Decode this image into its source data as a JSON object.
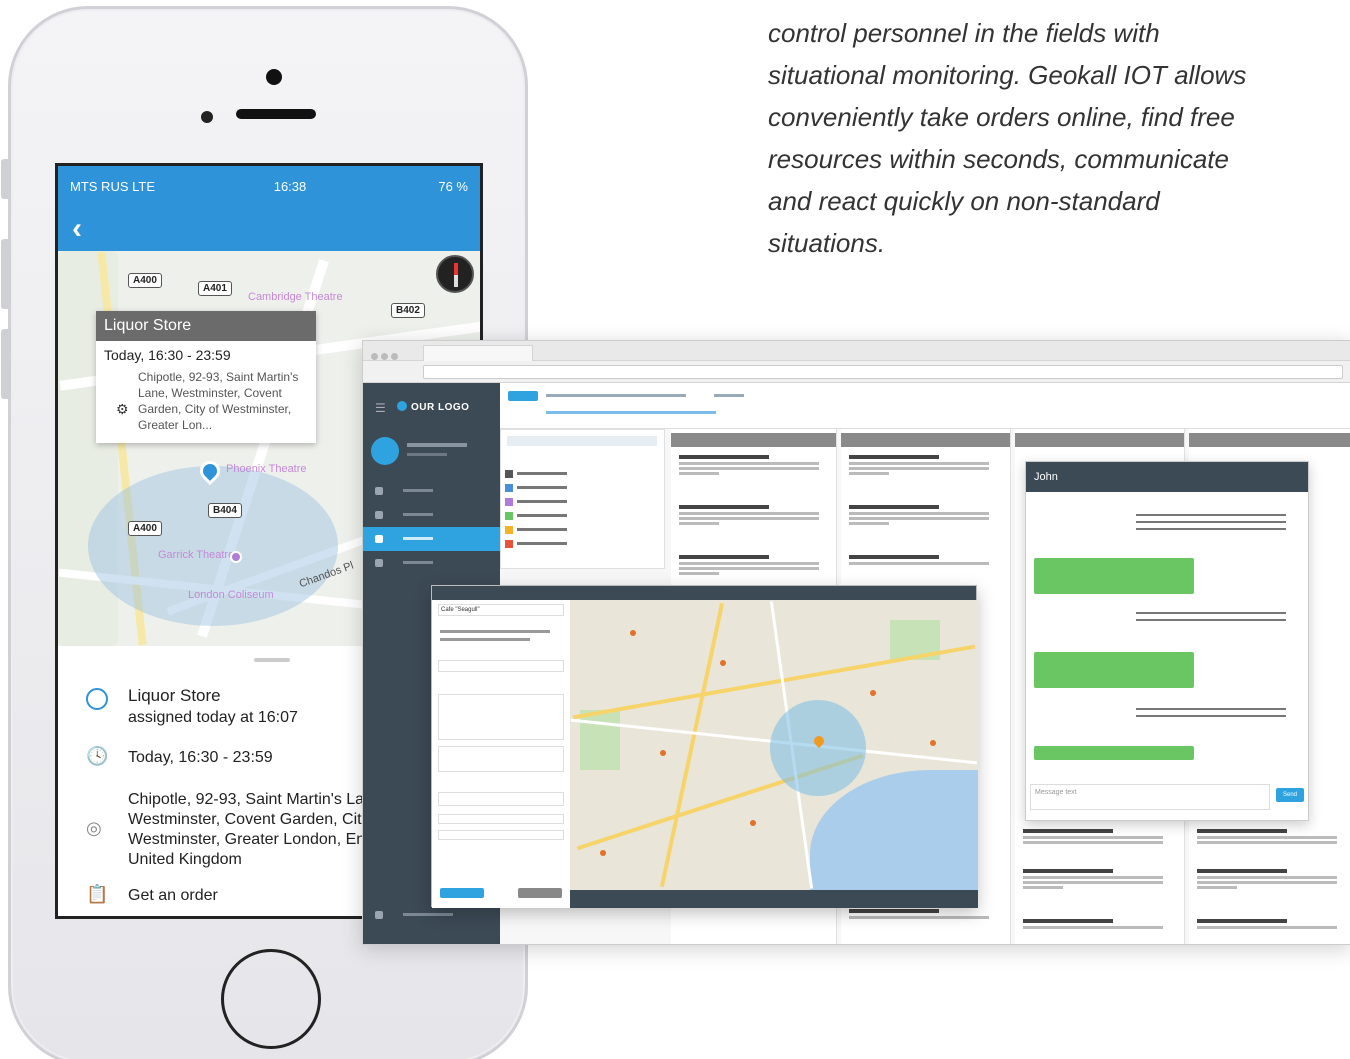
{
  "marketing": {
    "lines": [
      "control personnel in the fields with",
      "situational monitoring. Geokall IOT allows",
      "conveniently take orders online, find  free",
      "resources within seconds,  communicate",
      "and react quickly on  non-standard",
      "situations."
    ]
  },
  "phone": {
    "status": {
      "carrier": "MTS RUS  LTE",
      "time": "16:38",
      "battery": "76 %"
    },
    "map": {
      "road_labels": [
        "A400",
        "A401",
        "B402",
        "B404",
        "A400"
      ],
      "place_labels": [
        "Cambridge Theatre",
        "Phoenix Theatre",
        "Garrick Theatre",
        "London Coliseum",
        "Chandos Pl"
      ],
      "popup": {
        "title": "Liquor Store",
        "time": "Today, 16:30 - 23:59",
        "address": "Chipotle, 92-93, Saint Martin's Lane, Westminster, Covent Garden, City of Westminster, Greater Lon..."
      }
    },
    "details": {
      "name": "Liquor Store",
      "assigned": "assigned today at 16:07",
      "time": "Today, 16:30 - 23:59",
      "address_lines": [
        "Chipotle, 92-93, Saint Martin's La",
        "Westminster, Covent Garden, Cit",
        "Westminster, Greater London, En",
        "United Kingdom"
      ],
      "action": "Get an order"
    }
  },
  "desktop": {
    "logo": "OUR LOGO",
    "chat": {
      "title": "John",
      "placeholder": "Message text",
      "send": "Send"
    },
    "task": {
      "client": "Cafe \"Seagull\""
    }
  },
  "colors": {
    "accent": "#2e93d8",
    "sidebar": "#3c4a56",
    "chat_green": "#6ac563"
  }
}
